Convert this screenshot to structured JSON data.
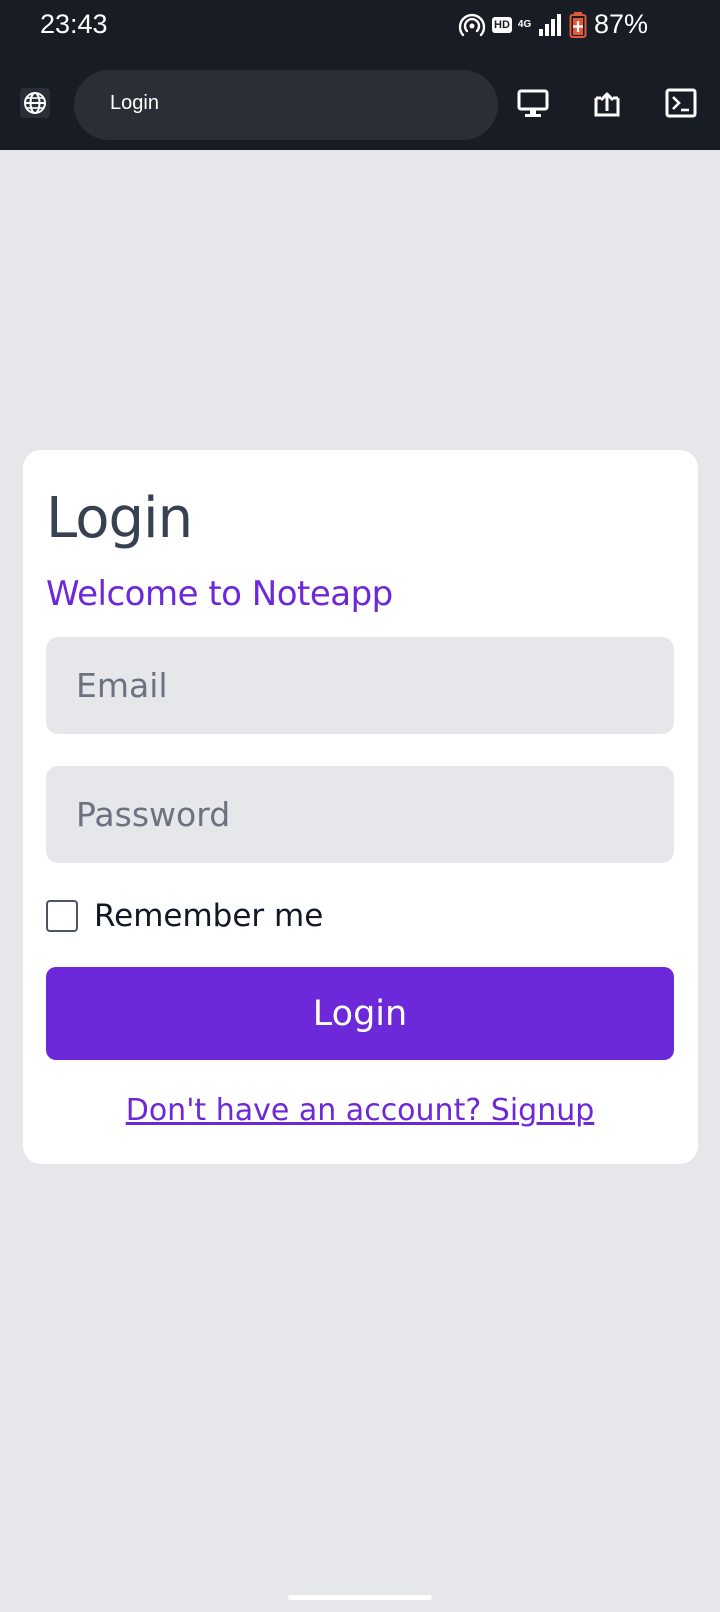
{
  "status_bar": {
    "time": "23:43",
    "hd": "HD",
    "network": "4G",
    "battery": "87%"
  },
  "browser": {
    "url_title": "Login",
    "icons": [
      "globe-icon",
      "desktop-icon",
      "share-up-icon",
      "terminal-icon"
    ]
  },
  "login_card": {
    "title": "Login",
    "subtitle": "Welcome to Noteapp",
    "email_placeholder": "Email",
    "email_value": "",
    "password_placeholder": "Password",
    "password_value": "",
    "remember_label": "Remember me",
    "remember_checked": false,
    "submit_label": "Login",
    "signup_link": "Don't have an account? Signup"
  },
  "colors": {
    "accent": "#6d28d9",
    "page_bg": "#e5e7eb",
    "bar_bg": "#181c24",
    "title": "#374151"
  }
}
